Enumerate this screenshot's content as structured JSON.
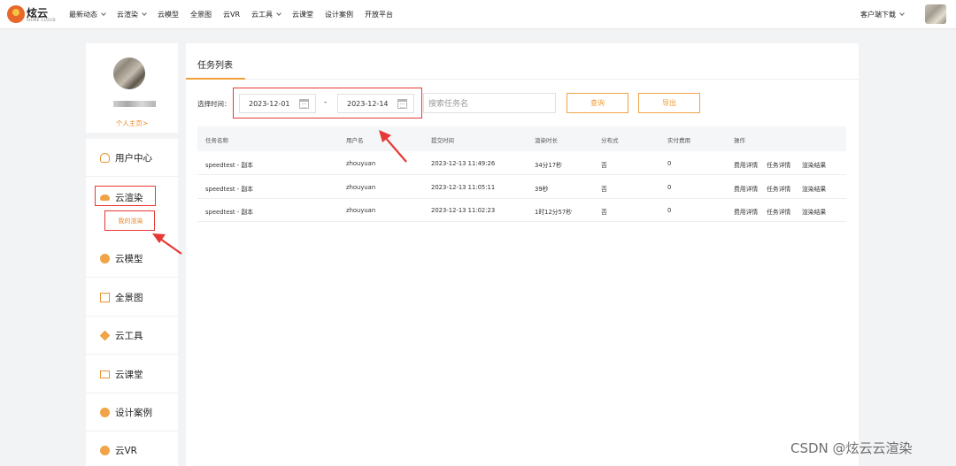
{
  "logo": {
    "name": "炫云",
    "subtitle": "SHINE CLOUD"
  },
  "nav": {
    "items": [
      {
        "label": "最新动态",
        "dropdown": true
      },
      {
        "label": "云渲染",
        "dropdown": true
      },
      {
        "label": "云模型",
        "dropdown": false
      },
      {
        "label": "全景图",
        "dropdown": false
      },
      {
        "label": "云VR",
        "dropdown": false
      },
      {
        "label": "云工具",
        "dropdown": true
      },
      {
        "label": "云课堂",
        "dropdown": false
      },
      {
        "label": "设计案例",
        "dropdown": false
      },
      {
        "label": "开放平台",
        "dropdown": false
      }
    ],
    "client_download": "客户端下载"
  },
  "profile": {
    "home_link": "个人主页>"
  },
  "sidebar": {
    "items": [
      {
        "label": "用户中心",
        "icon": "user-icon"
      },
      {
        "label": "云渲染",
        "icon": "cloud-render-icon"
      },
      {
        "label": "云模型",
        "icon": "cloud-model-icon"
      },
      {
        "label": "全景图",
        "icon": "panorama-icon"
      },
      {
        "label": "云工具",
        "icon": "cloud-tool-icon"
      },
      {
        "label": "云课堂",
        "icon": "cloud-class-icon"
      },
      {
        "label": "设计案例",
        "icon": "design-case-icon"
      },
      {
        "label": "云VR",
        "icon": "cloud-vr-icon"
      }
    ],
    "sub_item": "我的渲染"
  },
  "main": {
    "title": "任务列表",
    "filter": {
      "time_label": "选择时间：",
      "start_date": "2023-12-01",
      "end_date": "2023-12-14",
      "separator": "-",
      "search_placeholder": "搜索任务名",
      "query_button": "查询",
      "export_button": "导出"
    },
    "table": {
      "headers": [
        "任务名称",
        "用户名",
        "提交时间",
        "渲染时长",
        "分布式",
        "实付费用",
        "操作"
      ],
      "rows": [
        {
          "name": "speedtest - 副本",
          "user": "zhouyuan",
          "submit_time": "2023-12-13 11:49:26",
          "duration": "34分17秒",
          "distributed": "否",
          "cost": "0"
        },
        {
          "name": "speedtest - 副本",
          "user": "zhouyuan",
          "submit_time": "2023-12-13 11:05:11",
          "duration": "39秒",
          "distributed": "否",
          "cost": "0"
        },
        {
          "name": "speedtest - 副本",
          "user": "zhouyuan",
          "submit_time": "2023-12-13 11:02:23",
          "duration": "1时12分57秒",
          "distributed": "否",
          "cost": "0"
        }
      ],
      "actions": [
        "费用详情",
        "任务详情",
        "渲染结果"
      ]
    }
  },
  "watermark": "CSDN @炫云云渲染",
  "colors": {
    "accent": "#f0a447",
    "annotation": "#e53935"
  }
}
